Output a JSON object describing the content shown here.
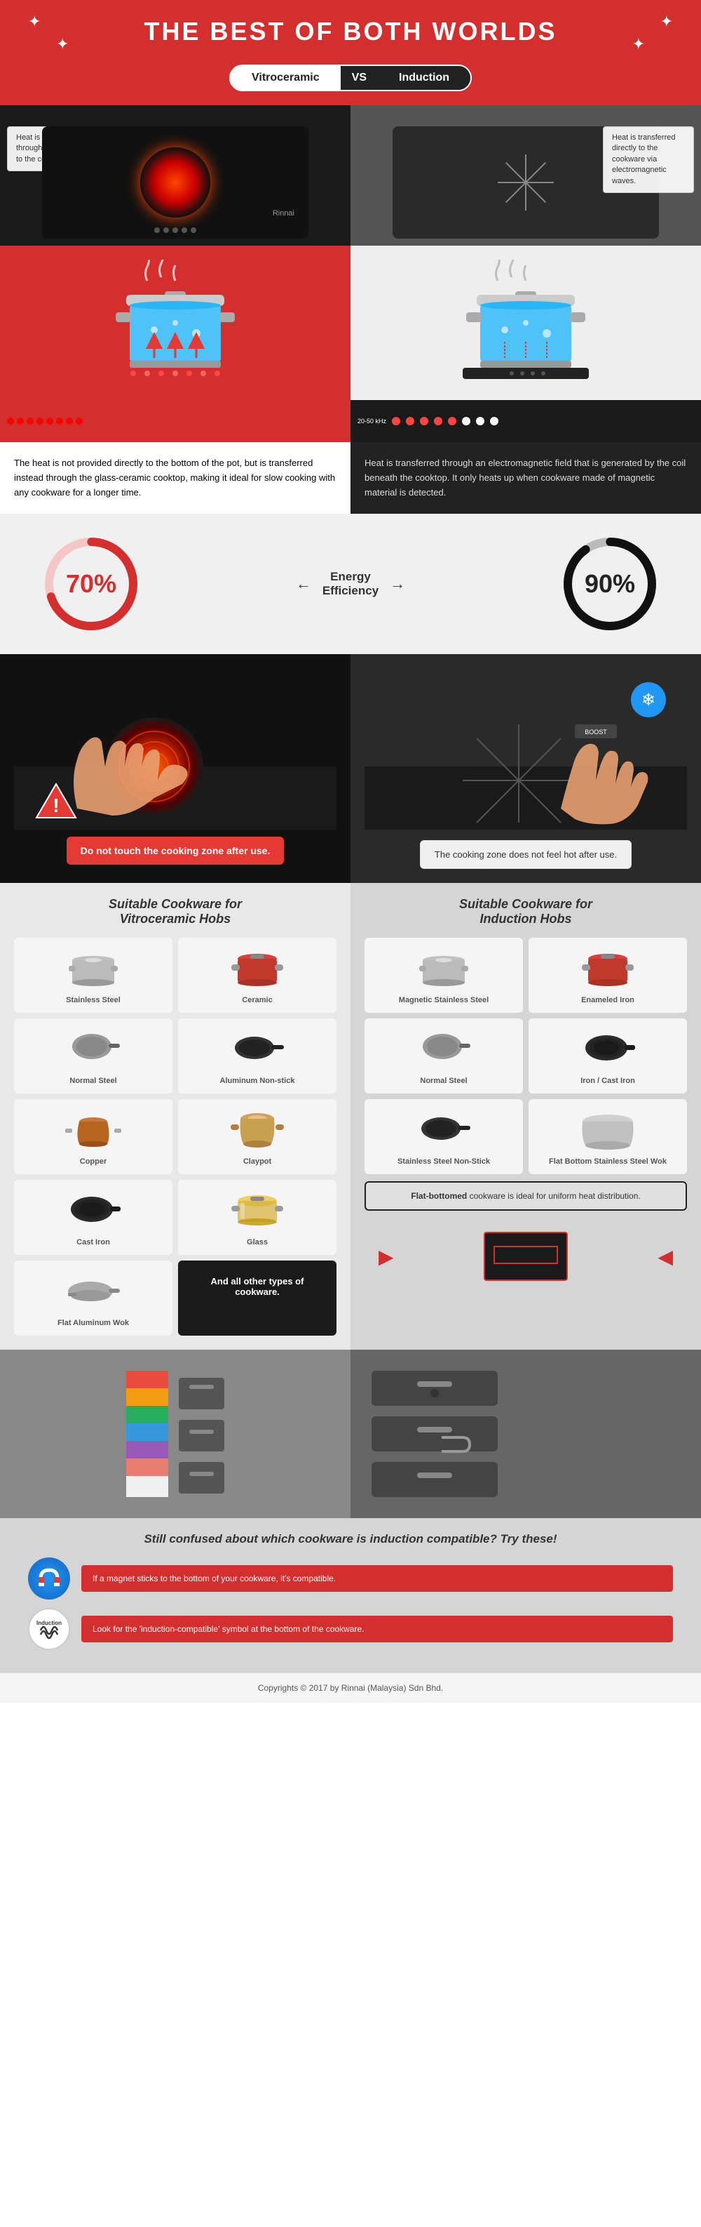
{
  "header": {
    "title": "THE BEST OF BOTH WORLDS",
    "vs_label": "VS",
    "left_label": "Vitroceramic",
    "right_label": "Induction"
  },
  "cooktop": {
    "vitro_tooltip": "Heat is transferred through the top plate to the cookware.",
    "induction_tooltip": "Heat is transferred directly to the cookware via electromagnetic waves.",
    "brand": "Rinnai"
  },
  "descriptions": {
    "vitro": "The heat is not provided directly to the bottom of the pot, but is transferred instead through the glass-ceramic cooktop, making it ideal for slow cooking with any cookware for a longer time.",
    "induction": "Heat is transferred through an electromagnetic field that is generated by the coil beneath the cooktop. It only heats up when cookware made of magnetic material is detected."
  },
  "energy": {
    "title": "Energy\nEfficiency",
    "vitro_pct": "70%",
    "induction_pct": "90%",
    "arrow_left": "←",
    "arrow_right": "→"
  },
  "touch": {
    "vitro_warning": "Do not touch the cooking zone after use.",
    "induction_safe": "The cooking zone does not feel hot after use.",
    "snow_icon": "❄"
  },
  "cookware_vitro": {
    "title": "Suitable Cookware for\nVitroceramic Hobs",
    "items": [
      {
        "label": "Stainless Steel",
        "color": "#c0c0c0"
      },
      {
        "label": "Ceramic",
        "color": "#c0392b"
      },
      {
        "label": "Normal Steel",
        "color": "#888"
      },
      {
        "label": "Aluminum Non-stick",
        "color": "#222"
      },
      {
        "label": "Copper",
        "color": "#b5651d"
      },
      {
        "label": "Claypot",
        "color": "#c8a96e"
      },
      {
        "label": "Cast Iron",
        "color": "#333"
      },
      {
        "label": "Glass",
        "color": "#d4af37"
      },
      {
        "label": "Flat Aluminum Wok",
        "color": "#aaa"
      }
    ],
    "all_other": "And all other types of cookware."
  },
  "cookware_induction": {
    "title": "Suitable Cookware for\nInduction Hobs",
    "items": [
      {
        "label": "Magnetic Stainless Steel",
        "color": "#c0c0c0"
      },
      {
        "label": "Enameled Iron",
        "color": "#c0392b"
      },
      {
        "label": "Normal Steel",
        "color": "#888"
      },
      {
        "label": "Iron / Cast Iron",
        "color": "#333"
      },
      {
        "label": "Stainless Steel Non-Stick",
        "color": "#222"
      },
      {
        "label": "Flat Bottom Stainless Steel Wok",
        "color": "#bbb"
      }
    ],
    "flat_note_bold": "Flat-bottomed",
    "flat_note_text": " cookware is ideal for uniform heat distribution."
  },
  "tip": {
    "title": "Still confused about which cookware is induction compatible? Try these!",
    "tip1_text": "If a magnet sticks to the bottom of your cookware, it's compatible.",
    "tip2_text": "Look for the 'induction-compatible' symbol at the bottom of the cookware."
  },
  "footer": {
    "copyright": "Copyrights © 2017 by Rinnai (Malaysia) Sdn Bhd."
  }
}
